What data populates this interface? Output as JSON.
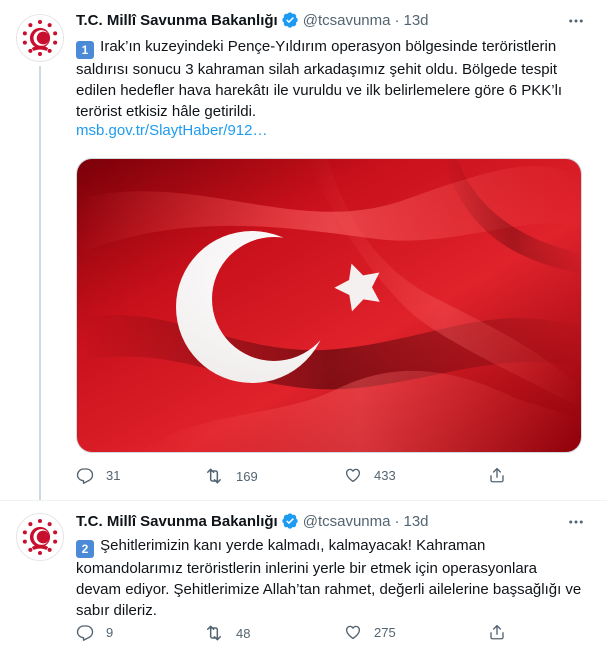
{
  "tweets": [
    {
      "author": {
        "name": "T.C. Millî Savunma Bakanlığı",
        "handle": "@tcsavunma"
      },
      "separator": "·",
      "time": "13d",
      "keycap": "1",
      "text": "Irak’ın kuzeyindeki Pençe-Yıldırım operasyon bölgesinde teröristlerin saldırısı sonucu 3 kahraman silah arkadaşımız şehit oldu. Bölgede tespit edilen hedefler hava harekâtı ile vuruldu ve ilk belirlemelere göre 6 PKK’lı terörist etkisiz hâle getirildi.",
      "link": "msb.gov.tr/SlaytHaber/912…",
      "media": "turkish-flag-image",
      "replies": "31",
      "retweets": "169",
      "likes": "433"
    },
    {
      "author": {
        "name": "T.C. Millî Savunma Bakanlığı",
        "handle": "@tcsavunma"
      },
      "separator": "·",
      "time": "13d",
      "keycap": "2",
      "text": "Şehitlerimizin kanı yerde kalmadı, kalmayacak! Kahraman komandolarımız teröristlerin inlerini yerle bir etmek için operasyonlara devam ediyor. Şehitlerimize Allah’tan rahmet, değerli ailelerine başsağlığı ve sabır dileriz.",
      "replies": "9",
      "retweets": "48",
      "likes": "275"
    }
  ],
  "icons": {
    "verified": "verified-badge-icon",
    "more": "more-options-icon",
    "reply": "reply-icon",
    "retweet": "retweet-icon",
    "like": "heart-icon",
    "share": "share-icon"
  },
  "colors": {
    "verified": "#1d9bf0",
    "link": "#1d9bf0",
    "secondary_text": "#536471",
    "keycap": "#4b8ad6",
    "flag_red": "#d3101b",
    "logo_red": "#c8102e"
  }
}
